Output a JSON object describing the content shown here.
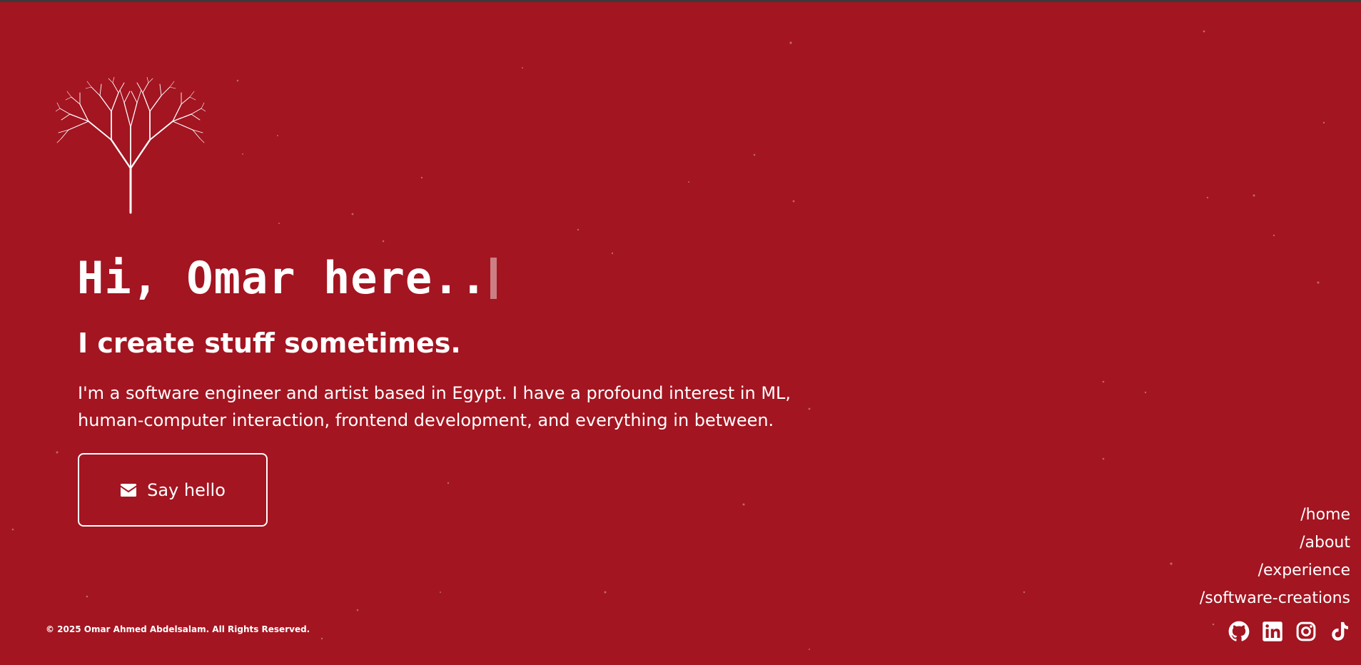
{
  "colors": {
    "background": "#a31521",
    "foreground": "#ffffff"
  },
  "logo": {
    "icon": "fractal-tree-icon"
  },
  "hero": {
    "title": "Hi, Omar here..",
    "tagline": "I create stuff sometimes.",
    "intro": "I'm a software engineer and artist based in Egypt. I have a profound interest in ML, human-computer interaction, frontend development, and everything in between."
  },
  "cta": {
    "label": "Say hello",
    "icon": "envelope-icon"
  },
  "nav": {
    "items": [
      {
        "label": "/home"
      },
      {
        "label": "/about"
      },
      {
        "label": "/experience"
      },
      {
        "label": "/software-creations"
      }
    ]
  },
  "socials": {
    "items": [
      {
        "icon": "github-icon"
      },
      {
        "icon": "linkedin-icon"
      },
      {
        "icon": "instagram-icon"
      },
      {
        "icon": "tiktok-icon"
      }
    ]
  },
  "footer": {
    "copyright": "© 2025 Omar Ahmed Abdelsalam. All Rights Reserved."
  }
}
